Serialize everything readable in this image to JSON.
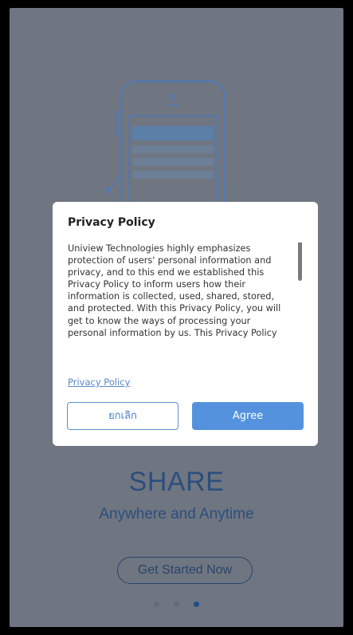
{
  "onboarding": {
    "title": "SHARE",
    "subtitle": "Anywhere and Anytime",
    "get_started_label": "Get Started Now",
    "page_count": 3,
    "active_page": 3
  },
  "dialog": {
    "title": "Privacy Policy",
    "body": "Uniview Technologies highly emphasizes protection of users' personal information and privacy, and to this end we established this Privacy Policy to inform users how their information is collected, used, shared, stored, and protected. With this Privacy Policy, you will get to know the ways of processing your personal information by us. This Privacy Policy",
    "link_label": "Privacy Policy",
    "cancel_label": "ยกเลิก",
    "agree_label": "Agree"
  },
  "colors": {
    "overlay_bg": "#6f7681",
    "accent": "#5592dd",
    "brand_text": "#2c4e7d"
  },
  "icons": {
    "illustration": "phone-illustration-icon"
  }
}
